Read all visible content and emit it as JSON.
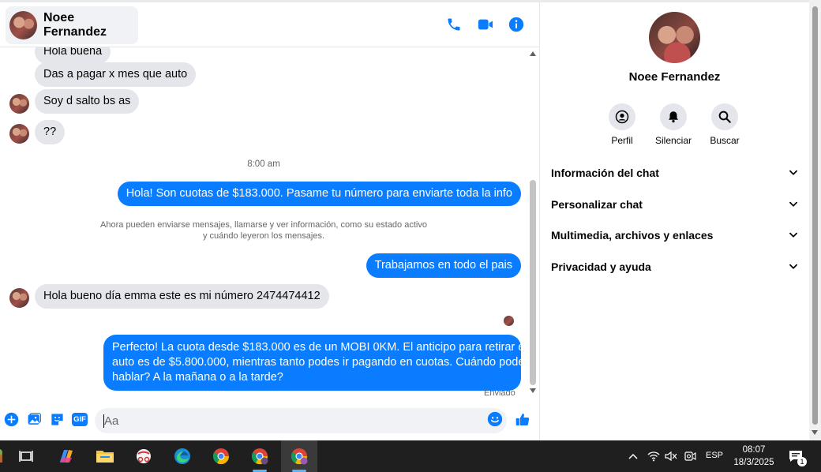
{
  "header": {
    "contact_name": "Noee Fernandez",
    "icons": [
      "phone-icon",
      "video-icon",
      "info-icon"
    ],
    "accent_color": "#0a7cff"
  },
  "messages": {
    "m1": "Hola buena",
    "m2": "Das a pagar x mes que auto",
    "m3": "Soy d salto bs as",
    "m4": "??",
    "time": "8:00 am",
    "m5": "Hola! Son cuotas de $183.000. Pasame tu número para enviarte toda la info",
    "notice_line1": "Ahora pueden enviarse mensajes, llamarse y ver información, como su estado activo",
    "notice_line2": "y cuándo leyeron los mensajes.",
    "m6": "Trabajamos en todo el pais",
    "m7": "Hola bueno día emma este es mi número 2474474412",
    "m8_line1": "Perfecto! La cuota desde $183.000 es de un MOBI 0KM. El anticipo para retirar el",
    "m8_line2": "auto es de $5.800.000, mientras tanto podes ir pagando en cuotas. Cuándo podes",
    "m8_line3": "hablar? A la mañana o a la tarde?",
    "status": "Enviado"
  },
  "composer": {
    "placeholder": "Aa",
    "gif_label": "GIF"
  },
  "details": {
    "name": "Noee Fernandez",
    "actions": [
      "Perfil",
      "Silenciar",
      "Buscar"
    ],
    "sections": [
      "Información del chat",
      "Personalizar chat",
      "Multimedia, archivos y enlaces",
      "Privacidad y ayuda"
    ]
  },
  "taskbar": {
    "language": "ESP",
    "time": "08:07",
    "date": "18/3/2025",
    "notification_count": "1"
  }
}
